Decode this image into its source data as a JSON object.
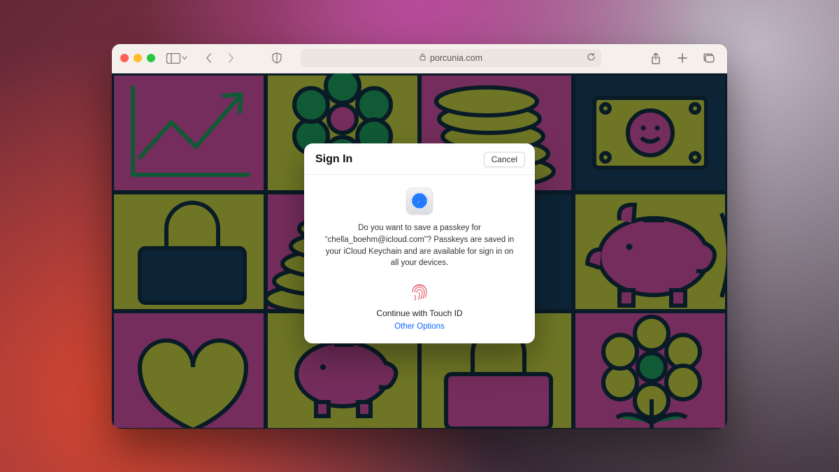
{
  "toolbar": {
    "address_text": "porcunia.com"
  },
  "modal": {
    "title": "Sign In",
    "cancel_label": "Cancel",
    "message": "Do you want to save a passkey for “chella_boehm@icloud.com”? Passkeys are saved in your iCloud Keychain and are available for sign in on all your devices.",
    "continue_label": "Continue with Touch ID",
    "other_options_label": "Other Options"
  },
  "colors": {
    "modal_link": "#0a66ff",
    "touchid": "#e46a7a",
    "safari_blue": "#1f7bff",
    "safari_red": "#ff3b30"
  }
}
